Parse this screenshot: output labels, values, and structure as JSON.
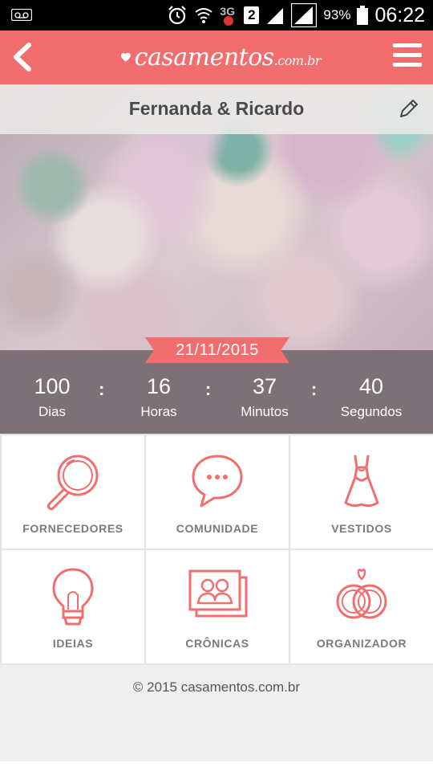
{
  "status_bar": {
    "battery_percent": "93%",
    "time": "06:22",
    "network_type": "3G",
    "sim_badge": "2"
  },
  "app_bar": {
    "brand_name": "casamentos",
    "brand_suffix": ".com.br"
  },
  "hero": {
    "couple_names": "Fernanda & Ricardo",
    "wedding_date": "21/11/2015"
  },
  "countdown": {
    "days": {
      "value": "100",
      "label": "Dias"
    },
    "hours": {
      "value": "16",
      "label": "Horas"
    },
    "minutes": {
      "value": "37",
      "label": "Minutos"
    },
    "seconds": {
      "value": "40",
      "label": "Segundos"
    },
    "separator": ":"
  },
  "menu_tiles": [
    {
      "label": "FORNECEDORES",
      "icon": "magnifier-icon"
    },
    {
      "label": "COMUNIDADE",
      "icon": "chat-bubble-icon"
    },
    {
      "label": "VESTIDOS",
      "icon": "dress-icon"
    },
    {
      "label": "IDEIAS",
      "icon": "lightbulb-icon"
    },
    {
      "label": "CRÔNICAS",
      "icon": "photos-icon"
    },
    {
      "label": "ORGANIZADOR",
      "icon": "rings-icon"
    }
  ],
  "footer": {
    "copyright": "© 2015 casamentos.com.br"
  },
  "colors": {
    "brand": "#f26d6d",
    "countdown_bg": "#7c7177",
    "tile_label": "#7a7a7a"
  }
}
